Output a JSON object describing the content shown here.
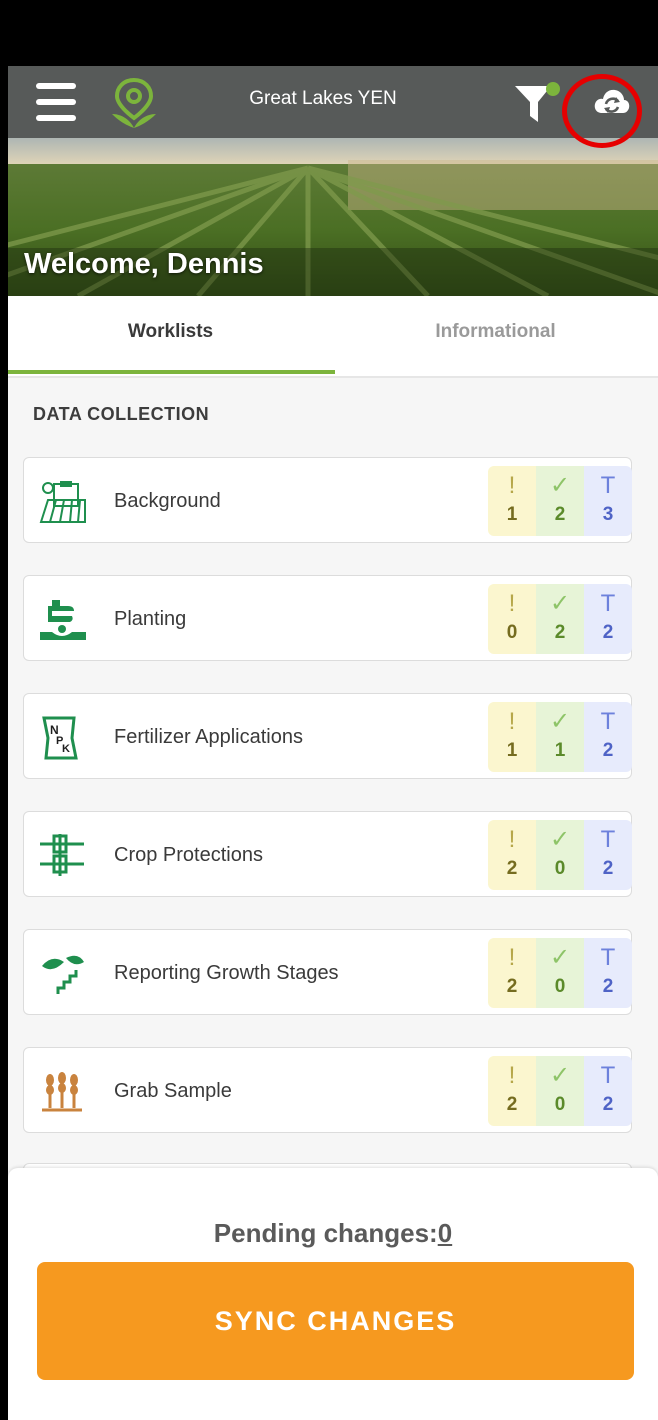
{
  "app": {
    "title": "Great Lakes YEN"
  },
  "header": {
    "welcome": "Welcome, Dennis"
  },
  "tabs": [
    {
      "label": "Worklists",
      "active": true
    },
    {
      "label": "Informational",
      "active": false
    }
  ],
  "section": {
    "title": "DATA COLLECTION"
  },
  "worklist": [
    {
      "label": "Background",
      "icon": "field-checklist-icon",
      "pending": "1",
      "done": "2",
      "total": "3"
    },
    {
      "label": "Planting",
      "icon": "planting-hand-icon",
      "pending": "0",
      "done": "2",
      "total": "2"
    },
    {
      "label": "Fertilizer Applications",
      "icon": "fertilizer-bag-icon",
      "pending": "1",
      "done": "1",
      "total": "2"
    },
    {
      "label": "Crop Protections",
      "icon": "sprayer-icon",
      "pending": "2",
      "done": "0",
      "total": "2"
    },
    {
      "label": "Reporting Growth Stages",
      "icon": "growth-stages-icon",
      "pending": "2",
      "done": "0",
      "total": "2"
    },
    {
      "label": "Grab Sample",
      "icon": "wheat-sample-icon",
      "pending": "2",
      "done": "0",
      "total": "2"
    }
  ],
  "symbols": {
    "pending": "!",
    "done": "✓",
    "total": "T"
  },
  "footer": {
    "pending_label": "Pending changes:",
    "pending_count": "0",
    "sync_label": "SYNC CHANGES"
  },
  "colors": {
    "appbar": "#575a59",
    "accent_green": "#7cb43c",
    "sync_orange": "#f6991f",
    "highlight_red": "#e60000"
  }
}
